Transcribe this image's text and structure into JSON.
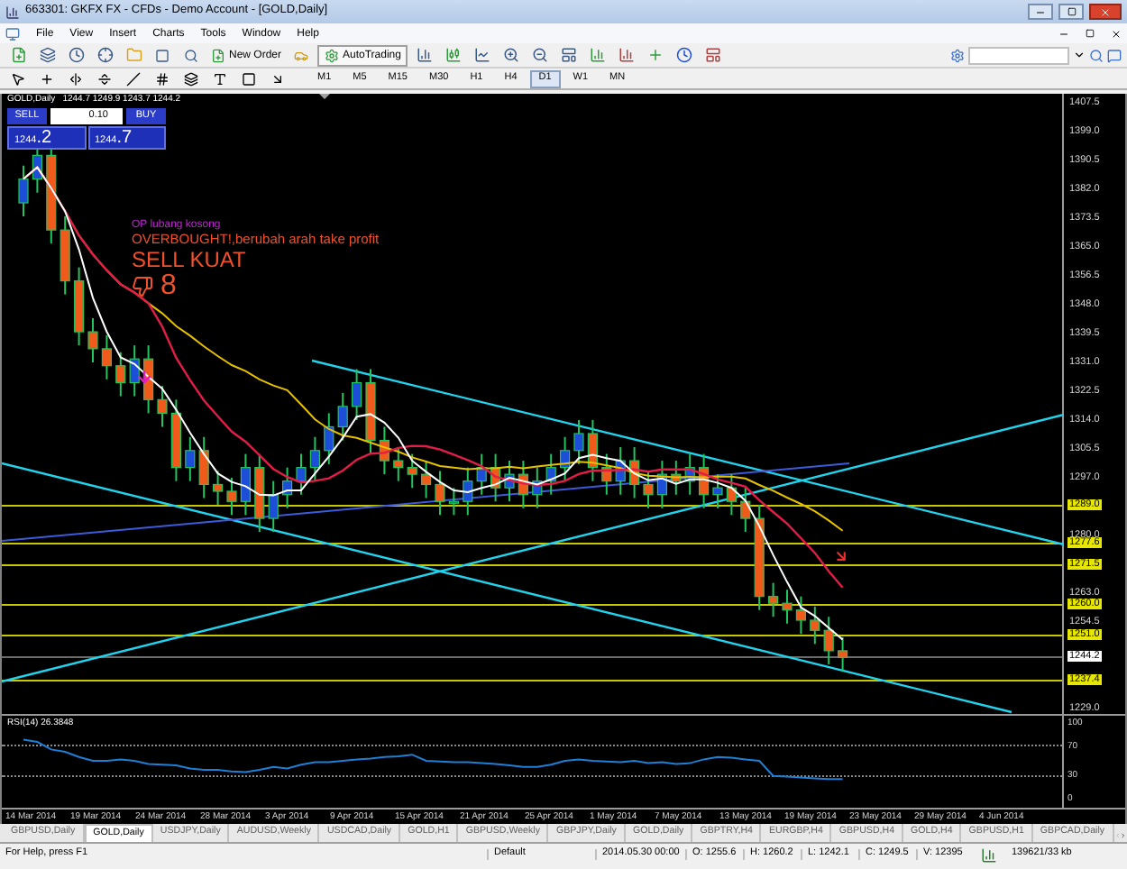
{
  "window": {
    "title": "663301: GKFX FX - CFDs - Demo Account - [GOLD,Daily]"
  },
  "menu": [
    "File",
    "View",
    "Insert",
    "Charts",
    "Tools",
    "Window",
    "Help"
  ],
  "toolbar": {
    "new_order": "New Order",
    "autotrading": "AutoTrading"
  },
  "timeframes": [
    {
      "label": "M1",
      "selected": false
    },
    {
      "label": "M5",
      "selected": false
    },
    {
      "label": "M15",
      "selected": false
    },
    {
      "label": "M30",
      "selected": false
    },
    {
      "label": "H1",
      "selected": false
    },
    {
      "label": "H4",
      "selected": false
    },
    {
      "label": "D1",
      "selected": true
    },
    {
      "label": "W1",
      "selected": false
    },
    {
      "label": "MN",
      "selected": false
    }
  ],
  "chart": {
    "symbol": "GOLD,Daily",
    "quote": "1244.7 1249.9 1243.7 1244.2",
    "trade_panel": {
      "sell": "SELL",
      "lot": "0.10",
      "buy": "BUY",
      "sell_price": "1244",
      "sell_pips": ".2",
      "buy_price": "1244",
      "buy_pips": ".7"
    },
    "annotations": [
      {
        "kind": "note",
        "text": "OP lubang kosong"
      },
      {
        "kind": "warning",
        "text": "OVERBOUGHT!,berubah arah take profit"
      },
      {
        "kind": "signal",
        "text": "SELL KUAT"
      },
      {
        "kind": "count",
        "text": "8"
      }
    ],
    "price_axis": [
      {
        "label": "1407.5",
        "kind": "tick"
      },
      {
        "label": "1399.0",
        "kind": "tick"
      },
      {
        "label": "1390.5",
        "kind": "tick"
      },
      {
        "label": "1382.0",
        "kind": "tick"
      },
      {
        "label": "1373.5",
        "kind": "tick"
      },
      {
        "label": "1365.0",
        "kind": "tick"
      },
      {
        "label": "1356.5",
        "kind": "tick"
      },
      {
        "label": "1348.0",
        "kind": "tick"
      },
      {
        "label": "1339.5",
        "kind": "tick"
      },
      {
        "label": "1331.0",
        "kind": "tick"
      },
      {
        "label": "1322.5",
        "kind": "tick"
      },
      {
        "label": "1314.0",
        "kind": "tick"
      },
      {
        "label": "1305.5",
        "kind": "tick"
      },
      {
        "label": "1297.0",
        "kind": "tick"
      },
      {
        "label": "1289.0",
        "kind": "level"
      },
      {
        "label": "1280.0",
        "kind": "tick"
      },
      {
        "label": "1277.6",
        "kind": "level"
      },
      {
        "label": "1271.5",
        "kind": "level"
      },
      {
        "label": "1263.0",
        "kind": "tick"
      },
      {
        "label": "1260.0",
        "kind": "level"
      },
      {
        "label": "1254.5",
        "kind": "tick"
      },
      {
        "label": "1251.0",
        "kind": "level"
      },
      {
        "label": "1244.2",
        "kind": "current"
      },
      {
        "label": "1237.4",
        "kind": "level"
      },
      {
        "label": "1229.0",
        "kind": "tick"
      }
    ]
  },
  "rsi": {
    "label": "RSI(14) 26.3848",
    "levels": [
      "100",
      "70",
      "30",
      "0"
    ]
  },
  "dates": [
    "14 Mar 2014",
    "19 Mar 2014",
    "24 Mar 2014",
    "28 Mar 2014",
    "3 Apr 2014",
    "9 Apr 2014",
    "15 Apr 2014",
    "21 Apr 2014",
    "25 Apr 2014",
    "1 May 2014",
    "7 May 2014",
    "13 May 2014",
    "19 May 2014",
    "23 May 2014",
    "29 May 2014",
    "4 Jun 2014"
  ],
  "tabs": [
    {
      "label": "GBPUSD,Daily",
      "selected": false
    },
    {
      "label": "GOLD,Daily",
      "selected": true
    },
    {
      "label": "USDJPY,Daily",
      "selected": false
    },
    {
      "label": "AUDUSD,Weekly",
      "selected": false
    },
    {
      "label": "USDCAD,Daily",
      "selected": false
    },
    {
      "label": "GOLD,H1",
      "selected": false
    },
    {
      "label": "GBPUSD,Weekly",
      "selected": false
    },
    {
      "label": "GBPJPY,Daily",
      "selected": false
    },
    {
      "label": "GOLD,Daily",
      "selected": false
    },
    {
      "label": "GBPTRY,H4",
      "selected": false
    },
    {
      "label": "EURGBP,H4",
      "selected": false
    },
    {
      "label": "GBPUSD,H4",
      "selected": false
    },
    {
      "label": "GOLD,H4",
      "selected": false
    },
    {
      "label": "GBPUSD,H1",
      "selected": false
    },
    {
      "label": "GBPCAD,Daily",
      "selected": false
    }
  ],
  "status_bar": {
    "help": "For Help, press F1",
    "profile": "Default",
    "datetime": "2014.05.30 00:00",
    "open": "O: 1255.6",
    "high": "H: 1260.2",
    "low": "L: 1242.1",
    "close": "C: 1249.5",
    "volume": "V: 12395",
    "traffic": "139621/33 kb"
  }
}
